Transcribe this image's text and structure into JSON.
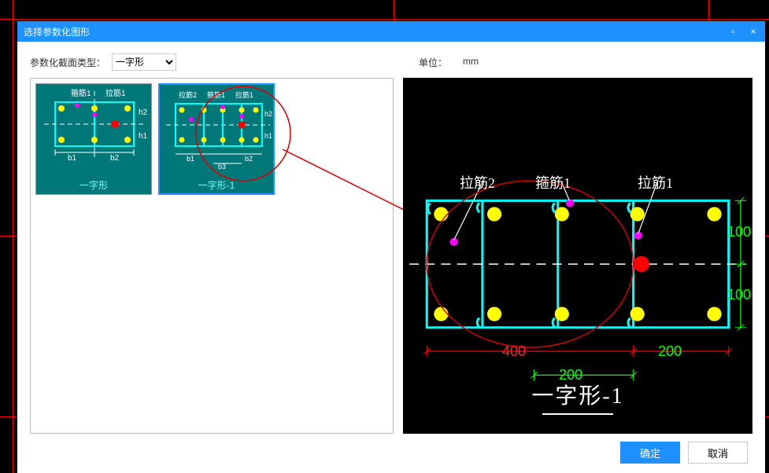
{
  "dialog": {
    "title": "选择参数化图形",
    "controls": {
      "min": "▫",
      "close": "×"
    }
  },
  "form": {
    "type_label": "参数化截面类型：",
    "type_value": "一字形",
    "unit_label": "单位：",
    "unit_value": "mm"
  },
  "thumbs": [
    {
      "caption": "一字形",
      "labels": {
        "stirrup": "箍筋1",
        "tie": "拉筋1"
      },
      "dims": {
        "b1": "b1",
        "b2": "b2",
        "h1": "h1",
        "h2": "h2"
      }
    },
    {
      "caption": "一字形-1",
      "labels": {
        "tie2": "拉筋2",
        "stirrup": "箍筋1",
        "tie1": "拉筋1"
      },
      "dims": {
        "b1": "b1",
        "b2": "b2",
        "b3": "b3",
        "h1": "h1",
        "h2": "h2"
      }
    }
  ],
  "preview": {
    "title": "一字形-1",
    "labels": {
      "tie2": "拉筋2",
      "stirrup": "箍筋1",
      "tie1": "拉筋1"
    },
    "dims": {
      "b1": "400",
      "b3": "200",
      "b2": "200",
      "h1": "100",
      "h2": "100"
    }
  },
  "buttons": {
    "ok": "确定",
    "cancel": "取消"
  },
  "chart_data": {
    "type": "diagram",
    "section_name": "一字形-1",
    "unit": "mm",
    "widths": {
      "b1": 400,
      "b3": 200,
      "b2": 200
    },
    "heights": {
      "h1": 100,
      "h2": 100
    },
    "rebars": [
      "拉筋2",
      "箍筋1",
      "拉筋1"
    ]
  }
}
